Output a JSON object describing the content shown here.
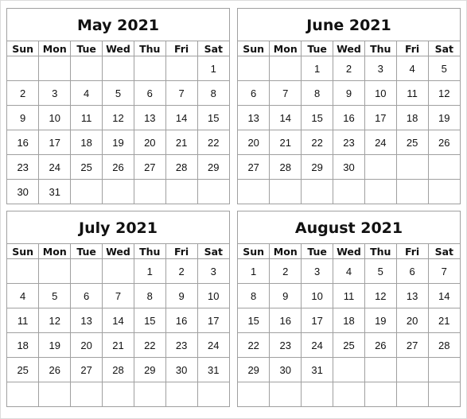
{
  "weekdays": [
    "Sun",
    "Mon",
    "Tue",
    "Wed",
    "Thu",
    "Fri",
    "Sat"
  ],
  "months": [
    {
      "title": "May 2021",
      "weeks": [
        [
          "",
          "",
          "",
          "",
          "",
          "",
          "1"
        ],
        [
          "2",
          "3",
          "4",
          "5",
          "6",
          "7",
          "8"
        ],
        [
          "9",
          "10",
          "11",
          "12",
          "13",
          "14",
          "15"
        ],
        [
          "16",
          "17",
          "18",
          "19",
          "20",
          "21",
          "22"
        ],
        [
          "23",
          "24",
          "25",
          "26",
          "27",
          "28",
          "29"
        ],
        [
          "30",
          "31",
          "",
          "",
          "",
          "",
          ""
        ]
      ]
    },
    {
      "title": "June 2021",
      "weeks": [
        [
          "",
          "",
          "1",
          "2",
          "3",
          "4",
          "5"
        ],
        [
          "6",
          "7",
          "8",
          "9",
          "10",
          "11",
          "12"
        ],
        [
          "13",
          "14",
          "15",
          "16",
          "17",
          "18",
          "19"
        ],
        [
          "20",
          "21",
          "22",
          "23",
          "24",
          "25",
          "26"
        ],
        [
          "27",
          "28",
          "29",
          "30",
          "",
          "",
          ""
        ],
        [
          "",
          "",
          "",
          "",
          "",
          "",
          ""
        ]
      ]
    },
    {
      "title": "July 2021",
      "weeks": [
        [
          "",
          "",
          "",
          "",
          "1",
          "2",
          "3"
        ],
        [
          "4",
          "5",
          "6",
          "7",
          "8",
          "9",
          "10"
        ],
        [
          "11",
          "12",
          "13",
          "14",
          "15",
          "16",
          "17"
        ],
        [
          "18",
          "19",
          "20",
          "21",
          "22",
          "23",
          "24"
        ],
        [
          "25",
          "26",
          "27",
          "28",
          "29",
          "30",
          "31"
        ],
        [
          "",
          "",
          "",
          "",
          "",
          "",
          ""
        ]
      ]
    },
    {
      "title": "August 2021",
      "weeks": [
        [
          "1",
          "2",
          "3",
          "4",
          "5",
          "6",
          "7"
        ],
        [
          "8",
          "9",
          "10",
          "11",
          "12",
          "13",
          "14"
        ],
        [
          "15",
          "16",
          "17",
          "18",
          "19",
          "20",
          "21"
        ],
        [
          "22",
          "23",
          "24",
          "25",
          "26",
          "27",
          "28"
        ],
        [
          "29",
          "30",
          "31",
          "",
          "",
          "",
          ""
        ],
        [
          "",
          "",
          "",
          "",
          "",
          "",
          ""
        ]
      ]
    }
  ]
}
